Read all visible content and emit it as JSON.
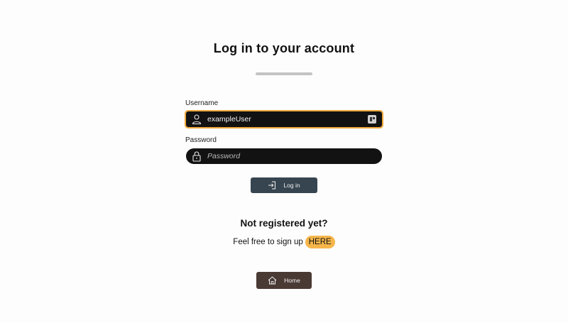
{
  "page": {
    "title": "Log in to your account"
  },
  "form": {
    "username": {
      "label": "Username",
      "value": "exampleUser",
      "placeholder": ""
    },
    "password": {
      "label": "Password",
      "value": "",
      "placeholder": "Password"
    },
    "login_button": {
      "label": "Log in"
    }
  },
  "register": {
    "heading": "Not registered yet?",
    "prompt": "Feel free to sign up",
    "link_label": "HERE"
  },
  "home_button": {
    "label": "Home"
  },
  "colors": {
    "focus_outline": "#f0a93b",
    "input_bg": "#121212",
    "login_button_bg": "#374550",
    "home_button_bg": "#4a3a34",
    "here_link_bg": "#f5b54a"
  },
  "icons": {
    "username": "user-icon",
    "password": "lock-icon",
    "password_manager": "password-manager-icon",
    "login": "login-icon",
    "home": "home-icon",
    "cursor": "text-cursor-icon"
  }
}
